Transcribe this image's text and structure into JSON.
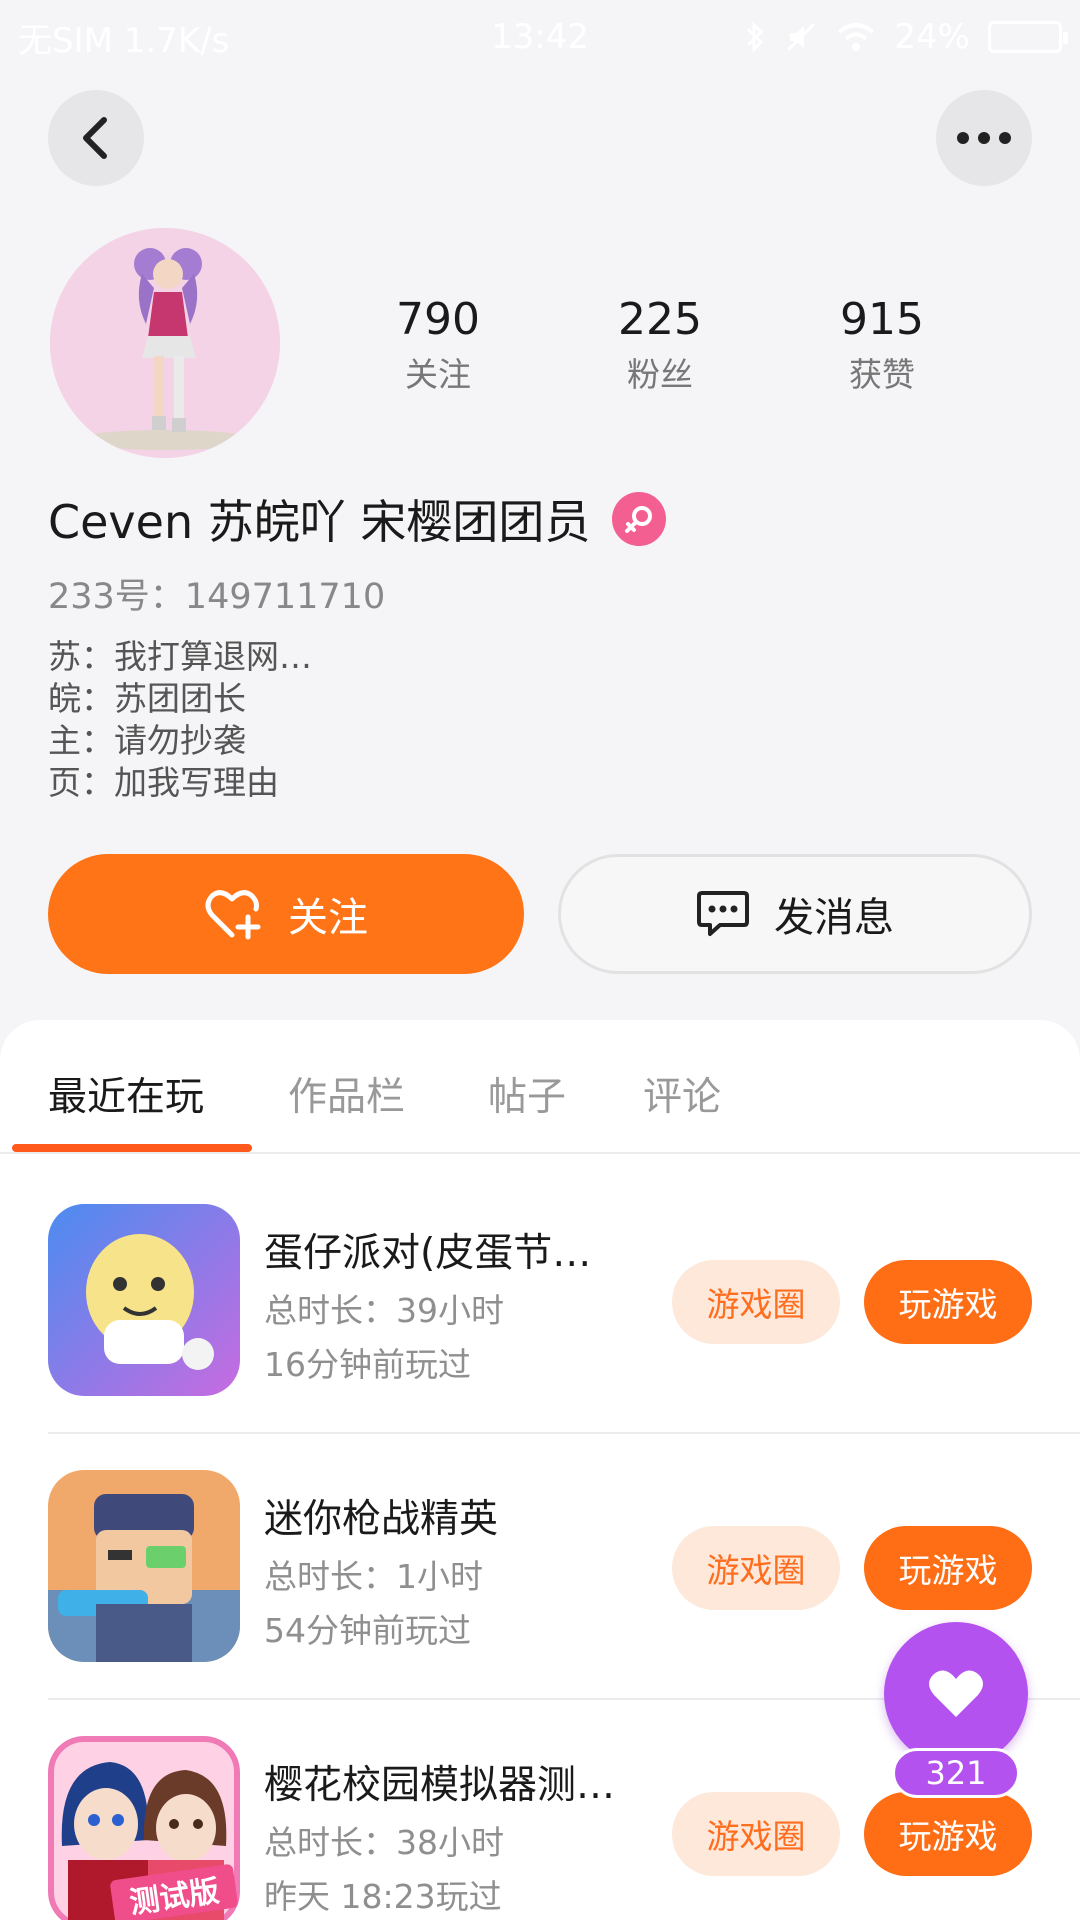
{
  "status_bar": {
    "left": "无SIM 1.7K/s",
    "time": "13:42",
    "battery": "24%"
  },
  "profile": {
    "stats": [
      {
        "value": "790",
        "label": "关注"
      },
      {
        "value": "225",
        "label": "粉丝"
      },
      {
        "value": "915",
        "label": "获赞"
      }
    ],
    "username": "Ceven  苏皖吖 宋樱团团员",
    "user_id": "233号：149711710",
    "bio": [
      "苏：我打算退网…",
      "皖：苏团团长",
      "主：请勿抄袭",
      "页：加我写理由"
    ]
  },
  "actions": {
    "follow_label": "关注",
    "message_label": "发消息"
  },
  "tabs": [
    "最近在玩",
    "作品栏",
    "帖子",
    "评论"
  ],
  "games": [
    {
      "name": "蛋仔派对(皮蛋节…",
      "duration": "总时长：39小时",
      "last_played": "16分钟前玩过",
      "circle_label": "游戏圈",
      "play_label": "玩游戏"
    },
    {
      "name": "迷你枪战精英",
      "duration": "总时长：1小时",
      "last_played": "54分钟前玩过",
      "circle_label": "游戏圈",
      "play_label": "玩游戏"
    },
    {
      "name": "樱花校园模拟器测…",
      "duration": "总时长：38小时",
      "last_played": "昨天 18:23玩过",
      "circle_label": "游戏圈",
      "play_label": "玩游戏",
      "icon_badge": "测试版"
    }
  ],
  "like_fab": {
    "count": "321"
  },
  "colors": {
    "accent": "#ff7417",
    "like": "#b452f0",
    "gender_badge": "#f45f91"
  },
  "icons": {
    "back": "chevron-left-icon",
    "more": "more-dots-icon",
    "follow": "heart-plus-icon",
    "message": "chat-bubble-icon",
    "gender": "female-icon",
    "like": "heart-icon"
  }
}
